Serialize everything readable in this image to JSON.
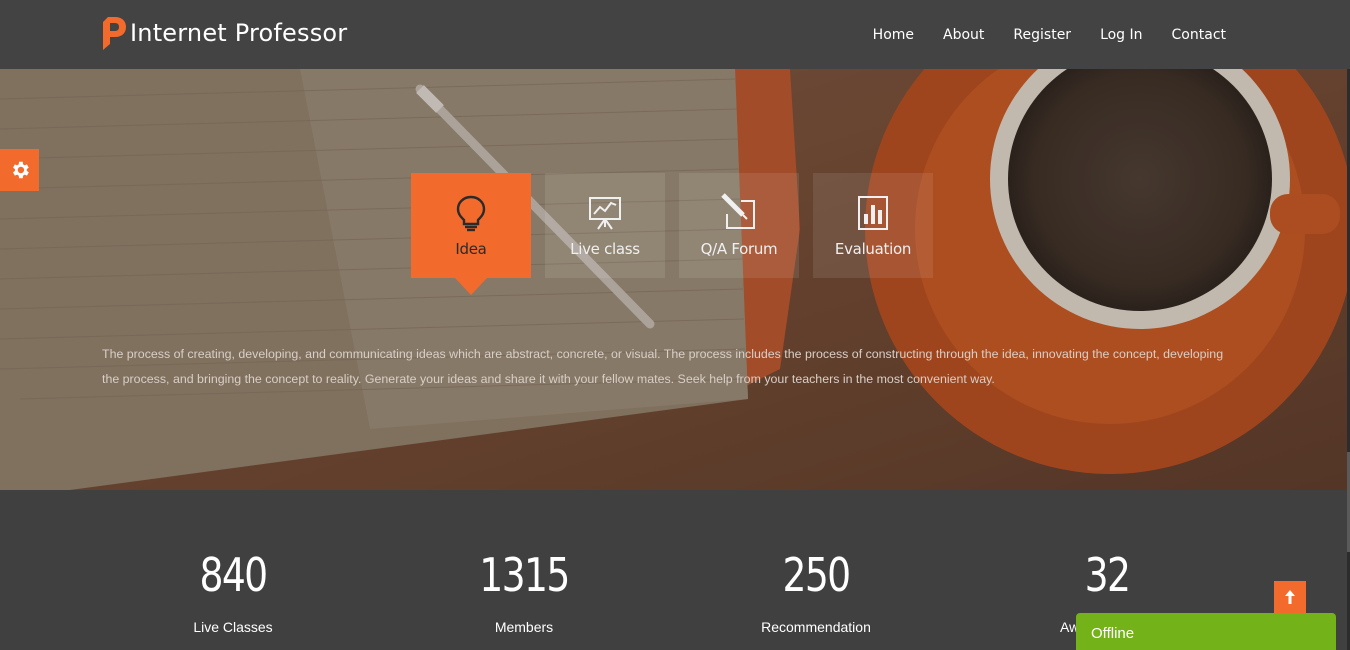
{
  "brand": {
    "name": "Internet Professor",
    "accent": "#f26a2c"
  },
  "nav": {
    "items": [
      {
        "label": "Home"
      },
      {
        "label": "About"
      },
      {
        "label": "Register"
      },
      {
        "label": "Log In"
      },
      {
        "label": "Contact"
      }
    ]
  },
  "settings": {
    "icon": "gear-icon"
  },
  "tabs": [
    {
      "label": "Idea",
      "icon": "lightbulb-icon",
      "active": true
    },
    {
      "label": "Live class",
      "icon": "presentation-board-icon",
      "active": false
    },
    {
      "label": "Q/A Forum",
      "icon": "pencil-square-icon",
      "active": false
    },
    {
      "label": "Evaluation",
      "icon": "bar-chart-icon",
      "active": false
    }
  ],
  "hero": {
    "text": "The process of creating, developing, and communicating ideas which are abstract, concrete, or visual. The process includes the process of constructing through the idea, innovating the concept, developing the process, and bringing the concept to reality. Generate your ideas and share it with your fellow mates. Seek help from your teachers in the most convenient way."
  },
  "stats": [
    {
      "value": "840",
      "label": "Live Classes"
    },
    {
      "value": "1315",
      "label": "Members"
    },
    {
      "value": "250",
      "label": "Recommendation"
    },
    {
      "value": "32",
      "label": "Aw"
    }
  ],
  "back_to_top": {
    "icon": "arrow-up-icon"
  },
  "chat": {
    "status": "Offline",
    "color": "#74b21a"
  }
}
